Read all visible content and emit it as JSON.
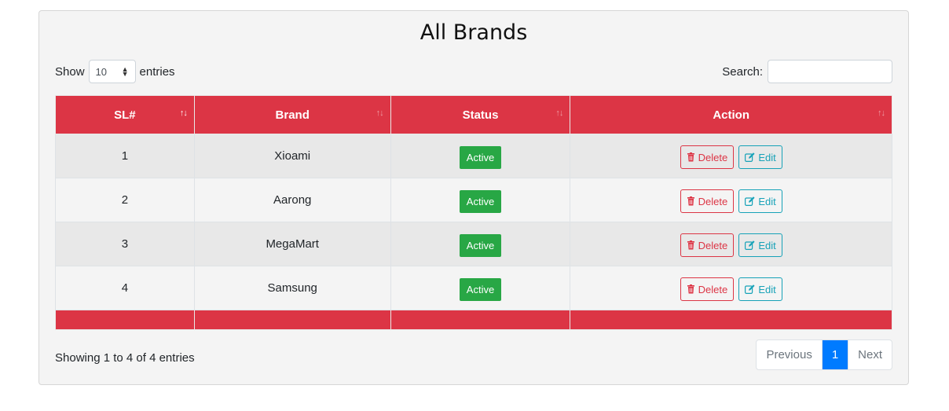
{
  "page": {
    "title": "All Brands"
  },
  "length": {
    "show_label": "Show",
    "selected": "10",
    "entries_label": "entries"
  },
  "search": {
    "label": "Search:",
    "value": ""
  },
  "table": {
    "headers": {
      "sl": "SL#",
      "brand": "Brand",
      "status": "Status",
      "action": "Action"
    },
    "rows": [
      {
        "sl": "1",
        "brand": "Xioami",
        "status": "Active",
        "delete": "Delete",
        "edit": "Edit"
      },
      {
        "sl": "2",
        "brand": "Aarong",
        "status": "Active",
        "delete": "Delete",
        "edit": "Edit"
      },
      {
        "sl": "3",
        "brand": "MegaMart",
        "status": "Active",
        "delete": "Delete",
        "edit": "Edit"
      },
      {
        "sl": "4",
        "brand": "Samsung",
        "status": "Active",
        "delete": "Delete",
        "edit": "Edit"
      }
    ]
  },
  "info": {
    "text": "Showing 1 to 4 of 4 entries"
  },
  "pagination": {
    "previous": "Previous",
    "current": "1",
    "next": "Next"
  },
  "icons": {
    "delete": "trash-icon",
    "edit": "edit-icon",
    "sort": "sort-icon",
    "select_caret": "caret-updown-icon"
  },
  "colors": {
    "header": "#dc3545",
    "badge": "#28a745",
    "delete": "#dc3545",
    "edit": "#17a2b8",
    "page_active": "#007bff"
  }
}
